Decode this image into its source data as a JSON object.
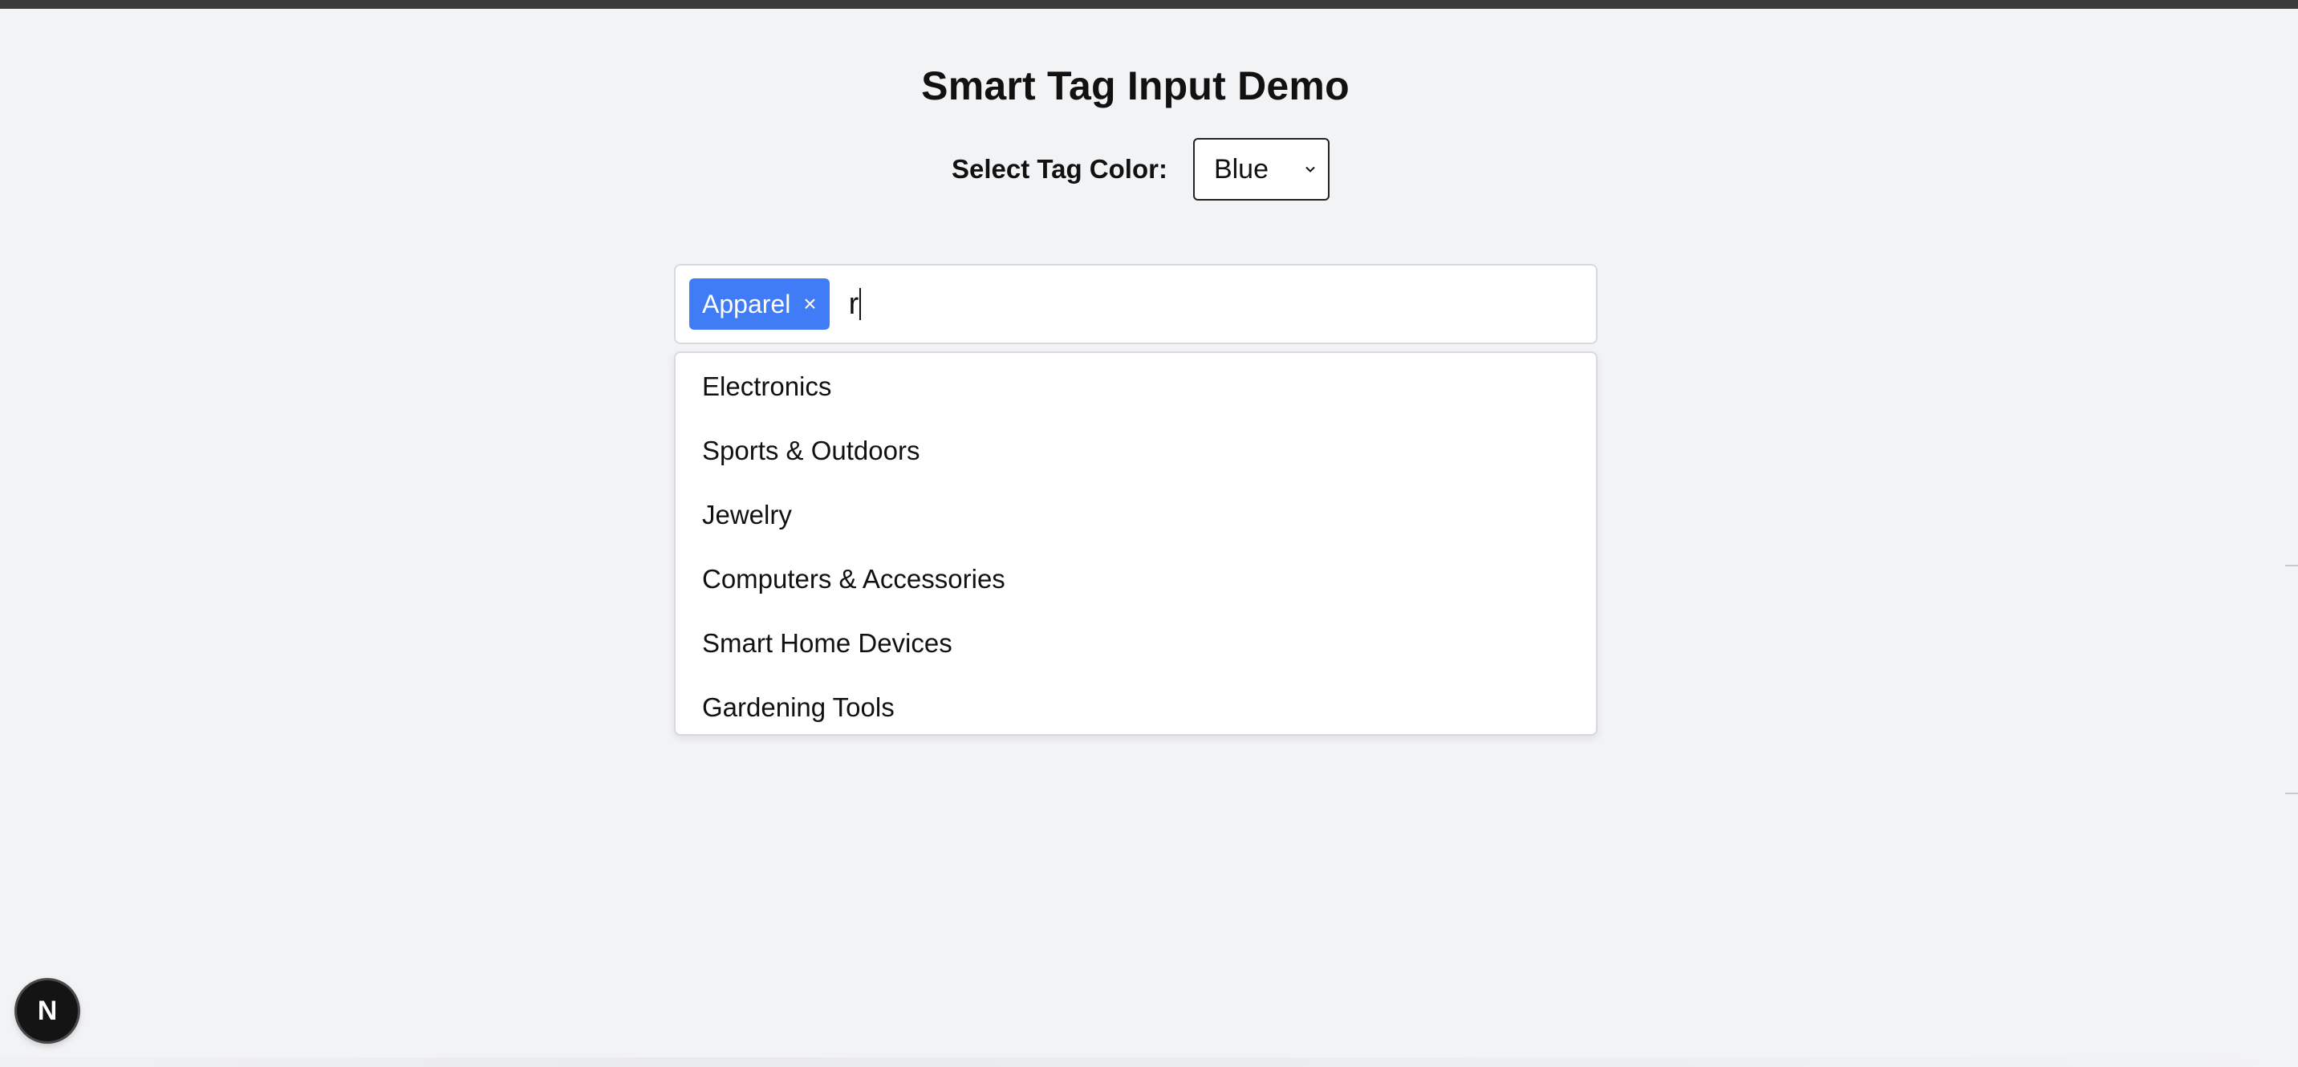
{
  "page": {
    "title": "Smart Tag Input Demo"
  },
  "color_picker": {
    "label": "Select Tag Color:",
    "selected": "Blue",
    "icon": "chevron-down-icon"
  },
  "tag_input": {
    "tags": [
      {
        "label": "Apparel",
        "remove_label": "×",
        "color": "#3f7cf6"
      }
    ],
    "typed_value": "r"
  },
  "suggestions": [
    "Electronics",
    "Sports & Outdoors",
    "Jewelry",
    "Computers & Accessories",
    "Smart Home Devices",
    "Gardening Tools"
  ],
  "badge": {
    "letter": "N",
    "icon": "nextjs-logo-icon"
  },
  "colors": {
    "background": "#f2f3f5",
    "tag_blue": "#3f7cf6",
    "top_bar": "#3a3b3a"
  }
}
